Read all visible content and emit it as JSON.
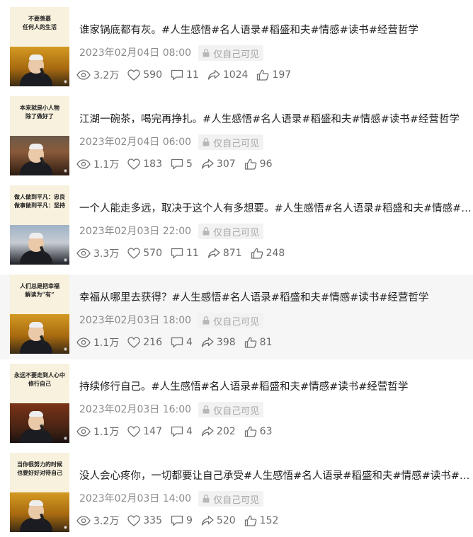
{
  "privacy_label": "仅自己可见",
  "posts": [
    {
      "title": "谁家锅底都有灰。#人生感悟#名人语录#稻盛和夫#情感#读书#经营哲学",
      "date": "2023年02月04日 08:00",
      "views": "3.2万",
      "likes": "590",
      "comments": "11",
      "shares": "1024",
      "upvotes": "197",
      "thumb_caption": "不要羡慕\n任何人的生活",
      "thumb_scene": "stage"
    },
    {
      "title": "江湖一碗茶，喝完再挣扎。#人生感悟#名人语录#稻盛和夫#情感#读书#经营哲学",
      "date": "2023年02月04日 06:00",
      "views": "1.1万",
      "likes": "183",
      "comments": "5",
      "shares": "307",
      "upvotes": "96",
      "thumb_caption": "本来就是小人物\n除了做好了",
      "thumb_scene": "indoor"
    },
    {
      "title": "一个人能走多远，取决于这个人有多想要。#人生感悟#名人语录#稻盛和夫#情感#读书#经营哲学",
      "date": "2023年02月03日 22:00",
      "views": "3.3万",
      "likes": "570",
      "comments": "11",
      "shares": "871",
      "upvotes": "248",
      "thumb_caption": "做人做到平凡：忠良\n做事做到平凡：坚持",
      "thumb_scene": "city"
    },
    {
      "title": "幸福从哪里去获得？#人生感悟#名人语录#稻盛和夫#情感#读书#经营哲学",
      "date": "2023年02月03日 18:00",
      "views": "1.1万",
      "likes": "216",
      "comments": "4",
      "shares": "398",
      "upvotes": "81",
      "thumb_caption": "人们总是把幸福\n解读为“有”",
      "thumb_scene": "stage"
    },
    {
      "title": "持续修行自己。#人生感悟#名人语录#稻盛和夫#情感#读书#经营哲学",
      "date": "2023年02月03日 16:00",
      "views": "1.1万",
      "likes": "147",
      "comments": "4",
      "shares": "202",
      "upvotes": "63",
      "thumb_caption": "永远不要走到人心中\n修行自己",
      "thumb_scene": "dark"
    },
    {
      "title": "没人会心疼你，一切都要让自己承受#人生感悟#名人语录#稻盛和夫#情感#读书#经营哲学",
      "date": "2023年02月03日 14:00",
      "views": "3.2万",
      "likes": "335",
      "comments": "9",
      "shares": "520",
      "upvotes": "152",
      "thumb_caption": "当你很努力的时候\n也要好好对待自己",
      "thumb_scene": "stage"
    }
  ]
}
